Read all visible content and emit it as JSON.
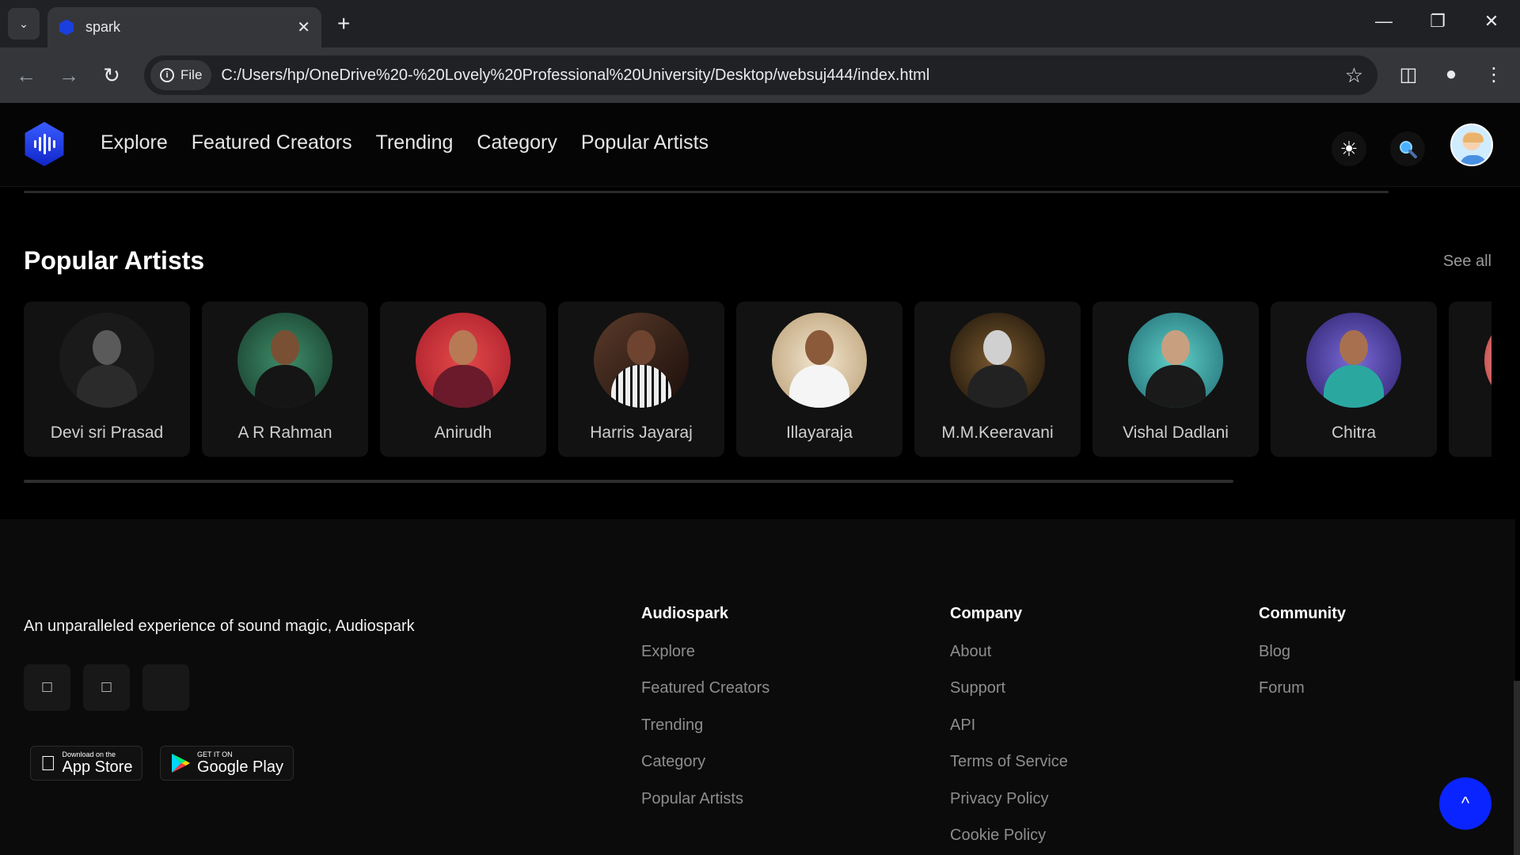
{
  "browser": {
    "tab_title": "spark",
    "file_label": "File",
    "url": "C:/Users/hp/OneDrive%20-%20Lovely%20Professional%20University/Desktop/websuj444/index.html"
  },
  "nav": {
    "items": [
      "Explore",
      "Featured Creators",
      "Trending",
      "Category",
      "Popular Artists"
    ]
  },
  "section": {
    "title": "Popular Artists",
    "see_all": "See all"
  },
  "artists": [
    {
      "name": "Devi sri Prasad"
    },
    {
      "name": "A R Rahman"
    },
    {
      "name": "Anirudh"
    },
    {
      "name": "Harris Jayaraj"
    },
    {
      "name": "Illayaraja"
    },
    {
      "name": "M.M.Keeravani"
    },
    {
      "name": "Vishal Dadlani"
    },
    {
      "name": "Chitra"
    }
  ],
  "footer": {
    "tagline": "An unparalleled experience of sound magic, Audiospark",
    "app_store": {
      "small": "Download on the",
      "big": "App Store"
    },
    "google_play": {
      "small": "GET IT ON",
      "big": "Google Play"
    },
    "columns": [
      {
        "title": "Audiospark",
        "links": [
          "Explore",
          "Featured Creators",
          "Trending",
          "Category",
          "Popular Artists"
        ]
      },
      {
        "title": "Company",
        "links": [
          "About",
          "Support",
          "API",
          "Terms of Service",
          "Privacy Policy",
          "Cookie Policy"
        ]
      },
      {
        "title": "Community",
        "links": [
          "Blog",
          "Forum"
        ]
      }
    ],
    "to_top": "^"
  },
  "colors": {
    "accent": "#0a24ff",
    "background": "#000000",
    "card": "#121212"
  },
  "icons": {
    "theme": "sun-icon",
    "search": "search-icon",
    "user": "avatar"
  }
}
